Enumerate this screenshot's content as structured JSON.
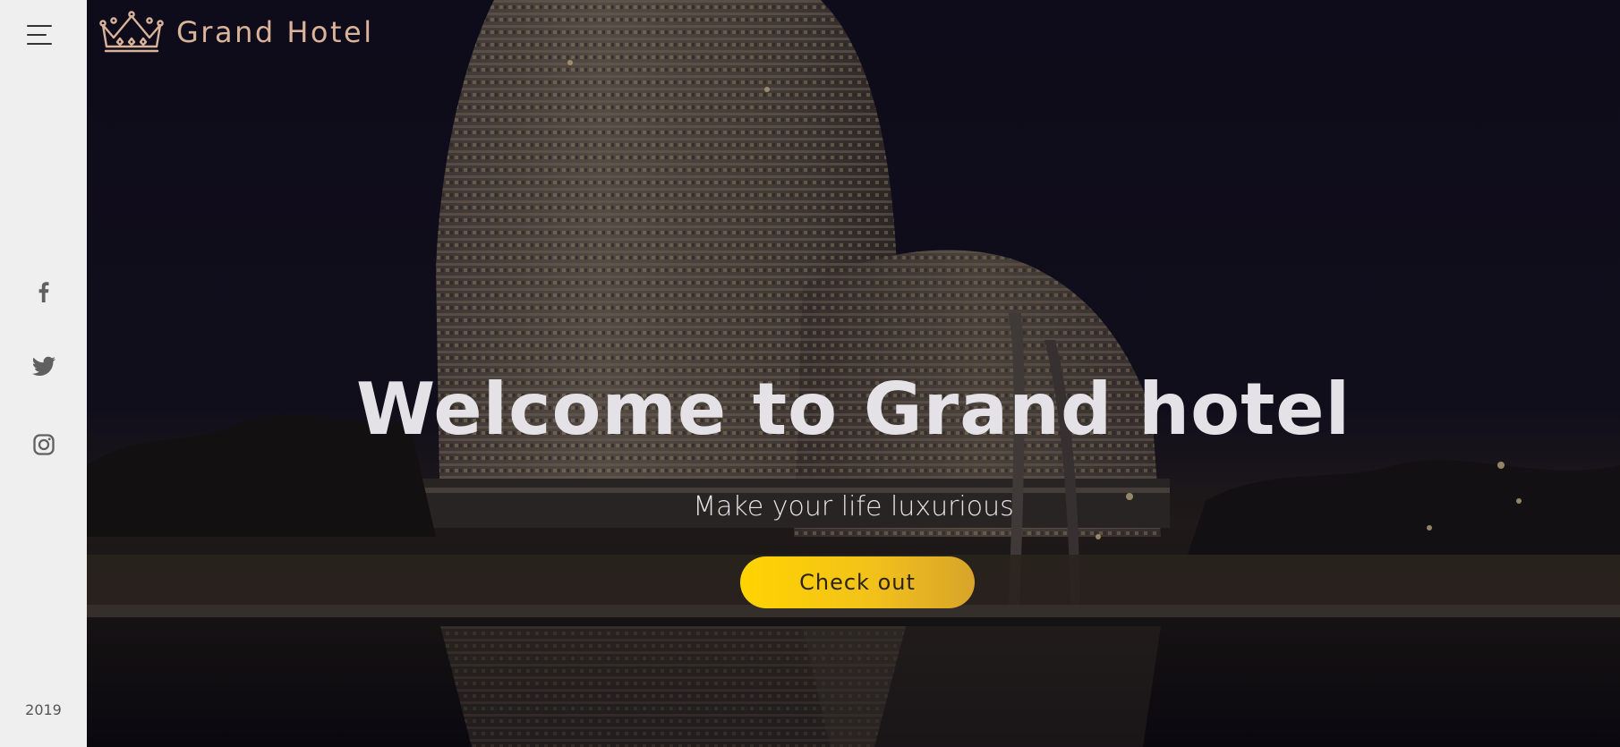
{
  "sidebar": {
    "menu_icon": "hamburger-menu-icon",
    "social": [
      {
        "name": "facebook",
        "icon": "facebook-icon"
      },
      {
        "name": "twitter",
        "icon": "twitter-icon"
      },
      {
        "name": "instagram",
        "icon": "instagram-icon"
      }
    ],
    "year": "2019"
  },
  "header": {
    "logo_icon": "crown-icon",
    "brand_name": "Grand Hotel"
  },
  "hero": {
    "title": "Welcome to Grand hotel",
    "subtitle": "Make your life luxurious",
    "cta_label": "Check out",
    "background": "night photo of a curved hotel tower reflected in water"
  },
  "colors": {
    "sidebar_bg": "#efefef",
    "brand_text": "#d9b39a",
    "cta_start": "#ffd400",
    "cta_end": "#d8a42a",
    "hero_text": "#e4e2e6"
  }
}
